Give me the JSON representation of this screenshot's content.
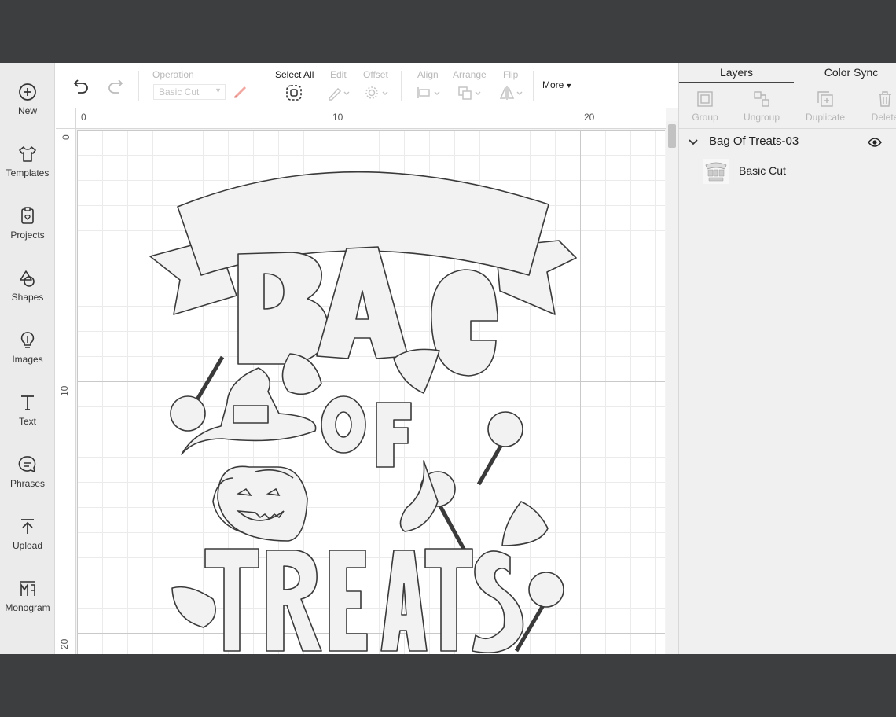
{
  "sidebar": {
    "items": [
      {
        "label": "New",
        "icon": "plus-circle-icon"
      },
      {
        "label": "Templates",
        "icon": "tshirt-icon"
      },
      {
        "label": "Projects",
        "icon": "projects-icon"
      },
      {
        "label": "Shapes",
        "icon": "shapes-icon"
      },
      {
        "label": "Images",
        "icon": "lightbulb-icon"
      },
      {
        "label": "Text",
        "icon": "text-icon"
      },
      {
        "label": "Phrases",
        "icon": "speech-bubble-icon"
      },
      {
        "label": "Upload",
        "icon": "upload-icon"
      },
      {
        "label": "Monogram",
        "icon": "monogram-icon"
      }
    ]
  },
  "toolbar": {
    "operation_label": "Operation",
    "operation_value": "Basic Cut",
    "select_all_label": "Select All",
    "edit_label": "Edit",
    "offset_label": "Offset",
    "align_label": "Align",
    "arrange_label": "Arrange",
    "flip_label": "Flip",
    "more_label": "More"
  },
  "canvas": {
    "ruler_top": [
      "0",
      "10",
      "20"
    ],
    "ruler_left": [
      "0",
      "10",
      "20"
    ]
  },
  "panel": {
    "tabs": [
      "Layers",
      "Color Sync"
    ],
    "tools": [
      "Group",
      "Ungroup",
      "Duplicate",
      "Delete"
    ],
    "layer_group_name": "Bag Of Treats-03",
    "layer_item_name": "Basic Cut"
  },
  "colors": {
    "frame": "#3d3e40",
    "sidebar_bg": "#ebebeb",
    "panel_bg": "#f0f0f0",
    "design_fill": "#f2f2f2",
    "design_stroke": "#3a3a3a"
  }
}
